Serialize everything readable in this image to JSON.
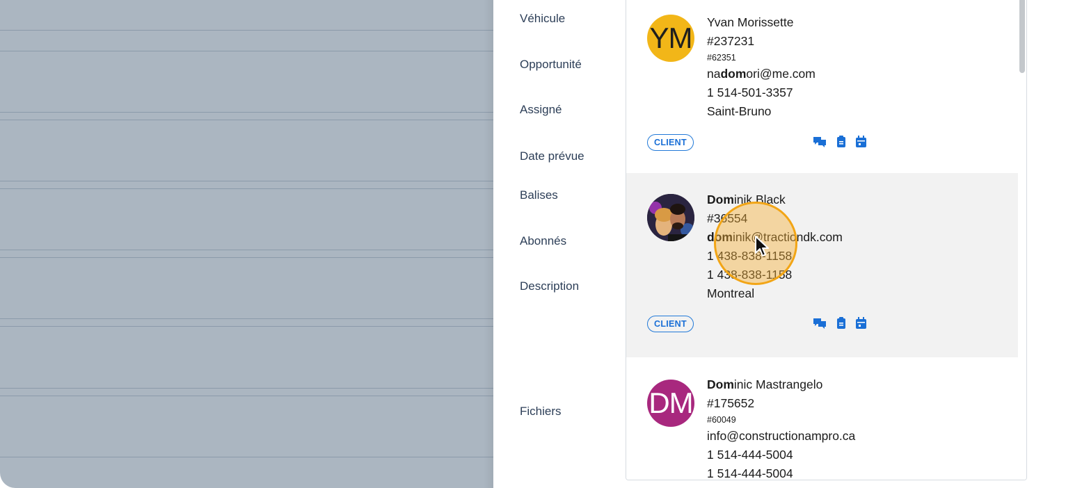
{
  "form_labels": [
    "Véhicule",
    "Opportunité",
    "Assigné",
    "Date prévue",
    "Balises",
    "Abonnés",
    "Description",
    "Fichiers"
  ],
  "contacts": [
    {
      "initials": "YM",
      "avatar_color": "#f2b618",
      "name_bold": "",
      "name_rest": "Yvan Morissette",
      "number": "#237231",
      "sub_number": "#62351",
      "email_pre": "na",
      "email_bold": "dom",
      "email_post": "ori@me.com",
      "phone1": "1 514-501-3357",
      "city": "Saint-Bruno",
      "badge": "CLIENT"
    },
    {
      "initials": "",
      "avatar_color": "#2a2440",
      "name_bold": "Dom",
      "name_rest": "inik Black",
      "number": "#36554",
      "email_pre": "",
      "email_bold": "dom",
      "email_post": "inik@tractiondk.com",
      "phone1": "1 438-838-1158",
      "phone2": "1 438-838-1158",
      "city": "Montreal",
      "badge": "CLIENT"
    },
    {
      "initials": "DM",
      "avatar_color": "#a8287e",
      "name_bold": "Dom",
      "name_rest": "inic Mastrangelo",
      "number": "#175652",
      "sub_number": "#60049",
      "email": "info@constructionampro.ca",
      "phone1": "1 514-444-5004",
      "phone2": "1 514-444-5004"
    }
  ],
  "icons": [
    "chat-icon",
    "clipboard-icon",
    "calendar-icon"
  ],
  "accent_color": "#1a6fd6"
}
